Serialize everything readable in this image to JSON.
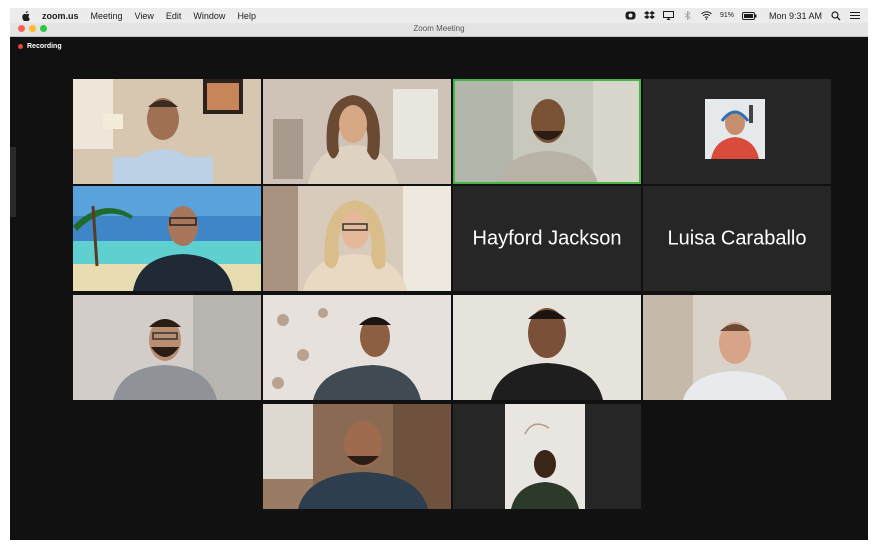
{
  "menubar": {
    "app_name": "zoom.us",
    "menus": [
      "Meeting",
      "View",
      "Edit",
      "Window",
      "Help"
    ],
    "battery": "91%",
    "clock": "Mon 9:31 AM"
  },
  "window": {
    "title": "Zoom Meeting"
  },
  "recording": {
    "label": "Recording",
    "color": "#e8443a"
  },
  "colors": {
    "active_speaker": "#45b545",
    "tile_bg": "#262626",
    "meeting_bg": "#111111"
  },
  "participants": [
    {
      "type": "video"
    },
    {
      "type": "video"
    },
    {
      "type": "video",
      "active": true
    },
    {
      "type": "profile-photo"
    },
    {
      "type": "video"
    },
    {
      "type": "video"
    },
    {
      "type": "name-only",
      "name": "Hayford Jackson"
    },
    {
      "type": "name-only",
      "name": "Luisa Caraballo"
    },
    {
      "type": "video"
    },
    {
      "type": "video"
    },
    {
      "type": "video"
    },
    {
      "type": "video"
    },
    {
      "type": "video"
    },
    {
      "type": "video"
    }
  ]
}
